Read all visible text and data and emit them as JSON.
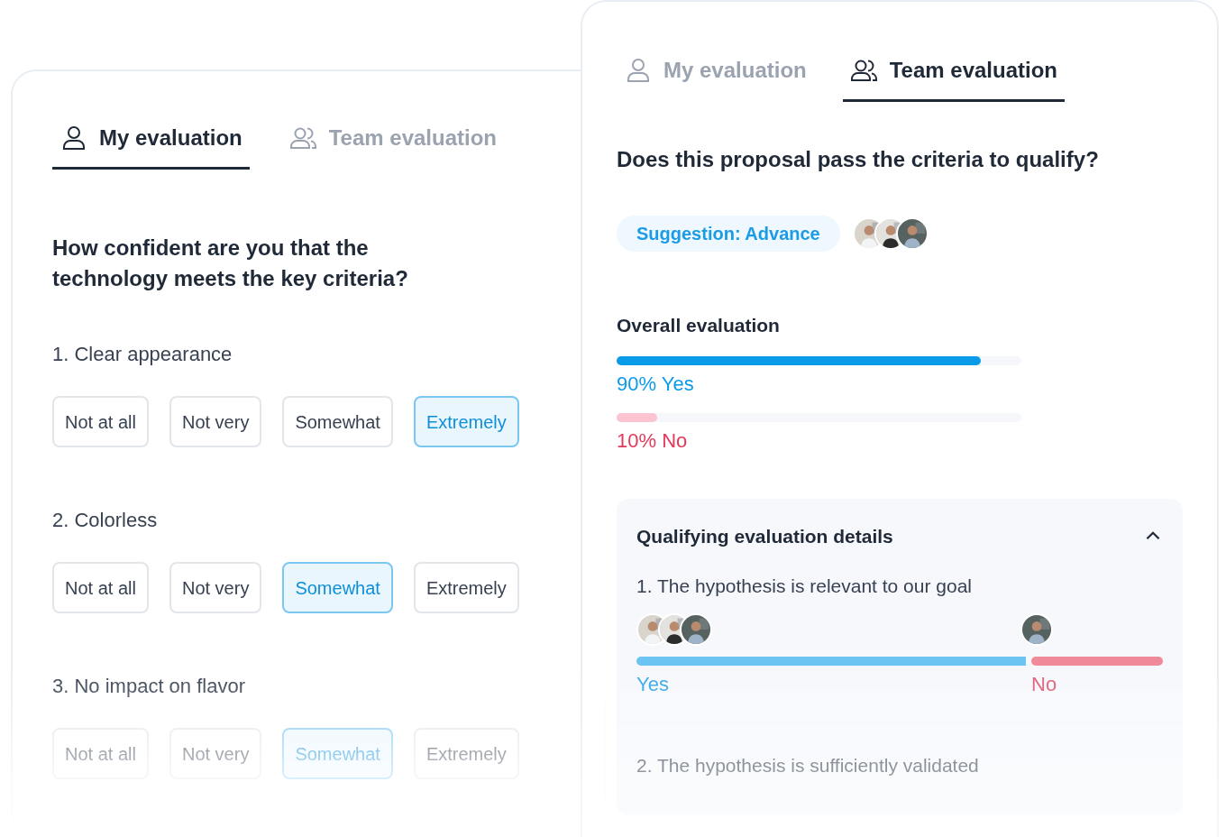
{
  "left_panel": {
    "tabs": [
      {
        "label": "My evaluation",
        "selected": true
      },
      {
        "label": "Team evaluation",
        "selected": false
      }
    ],
    "question": "How confident are you that the technology meets the key criteria?",
    "criteria": [
      {
        "label": "1. Clear appearance",
        "options": [
          {
            "label": "Not at all",
            "selected": false
          },
          {
            "label": "Not very",
            "selected": false
          },
          {
            "label": "Somewhat",
            "selected": false
          },
          {
            "label": "Extremely",
            "selected": true
          }
        ]
      },
      {
        "label": "2. Colorless",
        "options": [
          {
            "label": "Not at all",
            "selected": false
          },
          {
            "label": "Not very",
            "selected": false
          },
          {
            "label": "Somewhat",
            "selected": true
          },
          {
            "label": "Extremely",
            "selected": false
          }
        ]
      },
      {
        "label": "3. No impact on flavor",
        "options": [
          {
            "label": "Not at all",
            "selected": false
          },
          {
            "label": "Not very",
            "selected": false
          },
          {
            "label": "Somewhat",
            "selected": true
          },
          {
            "label": "Extremely",
            "selected": false
          }
        ]
      }
    ]
  },
  "right_panel": {
    "tabs": [
      {
        "label": "My evaluation",
        "selected": false
      },
      {
        "label": "Team evaluation",
        "selected": true
      }
    ],
    "question": "Does this proposal pass the criteria to qualify?",
    "suggestion": {
      "label": "Suggestion: Advance"
    },
    "overall": {
      "title": "Overall evaluation",
      "results": [
        {
          "kind": "yes",
          "label": "90% Yes",
          "level": 0.9
        },
        {
          "kind": "no",
          "label": "10% No",
          "level": 0.1
        }
      ]
    },
    "details": {
      "title": "Qualifying evaluation details",
      "expanded": true,
      "items": [
        {
          "label": "1. The hypothesis is relevant to our goal",
          "votes": [
            {
              "kind": "yes",
              "label": "Yes"
            },
            {
              "kind": "no",
              "label": "No"
            }
          ]
        },
        {
          "label": "2. The hypothesis is sufficiently validated"
        }
      ]
    }
  }
}
